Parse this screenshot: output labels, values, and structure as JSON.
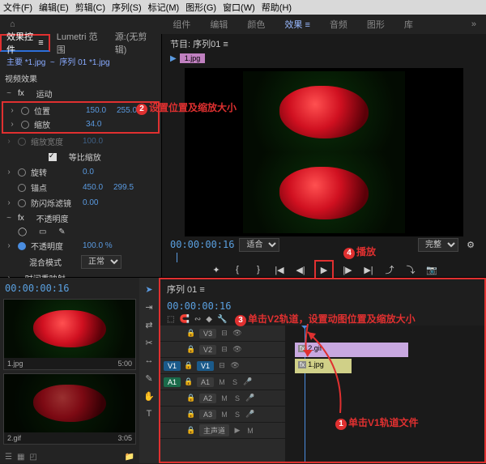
{
  "menu": [
    "文件(F)",
    "编辑(E)",
    "剪辑(C)",
    "序列(S)",
    "标记(M)",
    "图形(G)",
    "窗口(W)",
    "帮助(H)"
  ],
  "workspaces": {
    "items": [
      "组件",
      "编辑",
      "颜色",
      "效果",
      "音频",
      "图形",
      "库"
    ],
    "active": "效果"
  },
  "effectControls": {
    "tabs": [
      "效果控件",
      "Lumetri 范围",
      "源:(无剪辑)"
    ],
    "activeTab": "效果控件",
    "breadcrumb_master": "主要 *1.jpg",
    "breadcrumb_seq": "序列 01 *1.jpg",
    "section_video": "视频效果",
    "motion": "运动",
    "position_label": "位置",
    "position_x": "150.0",
    "position_y": "255.0",
    "scale_label": "缩放",
    "scale_val": "34.0",
    "aspect_label": "缩放宽度",
    "aspect_val": "100.0",
    "uniform": "等比缩放",
    "rotation_label": "旋转",
    "rotation_val": "0.0",
    "anchor_label": "锚点",
    "anchor_x": "450.0",
    "anchor_y": "299.5",
    "flicker_label": "防闪烁滤镜",
    "flicker_val": "0.00",
    "opacity": "不透明度",
    "opacity_label": "不透明度",
    "opacity_val": "100.0 %",
    "blend_label": "混合模式",
    "blend_val": "正常",
    "remap": "时间重映射"
  },
  "program": {
    "title": "节目: 序列01",
    "clip": "1.jpg",
    "timecode": "00:00:00:16",
    "fit": "适合",
    "full": "完整"
  },
  "project": {
    "timecode": "00:00:00:16",
    "thumb1_name": "1.jpg",
    "thumb1_dur": "5:00",
    "thumb2_name": "2.gif",
    "thumb2_dur": "3:05"
  },
  "timeline": {
    "title": "序列 01",
    "timecode": "00:00:00:16",
    "tracks_v": [
      "V3",
      "V2",
      "V1"
    ],
    "tracks_a": [
      "A1",
      "A2",
      "A3"
    ],
    "master": "主声道",
    "clip_v2": "2.gif",
    "clip_v1": "1.jpg",
    "src_v": "V1",
    "src_a": "A1"
  },
  "annotations": {
    "a1": "单击V1轨道文件",
    "a2": "设置位置及缩放大小",
    "a3": "单击V2轨道，设置动图位置及缩放大小",
    "a4": "播放"
  }
}
